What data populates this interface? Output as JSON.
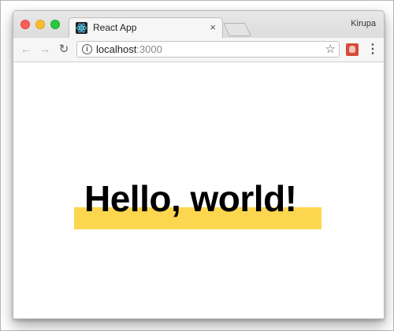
{
  "window": {
    "profile_name": "Kirupa"
  },
  "tab": {
    "title": "React App",
    "close_glyph": "×",
    "favicon": "react-icon"
  },
  "toolbar": {
    "back_glyph": "←",
    "forward_glyph": "→",
    "reload_glyph": "↻",
    "info_glyph": "i",
    "url_host": "localhost",
    "url_port": ":3000",
    "star_glyph": "☆",
    "menu_glyph": "⋮"
  },
  "content": {
    "heading": "Hello, world!",
    "highlight_color": "#fcd64e"
  },
  "colors": {
    "traffic_close": "#fc5f57",
    "traffic_minimize": "#fdbc2e",
    "traffic_maximize": "#28c840",
    "react_blue": "#61dafb"
  }
}
